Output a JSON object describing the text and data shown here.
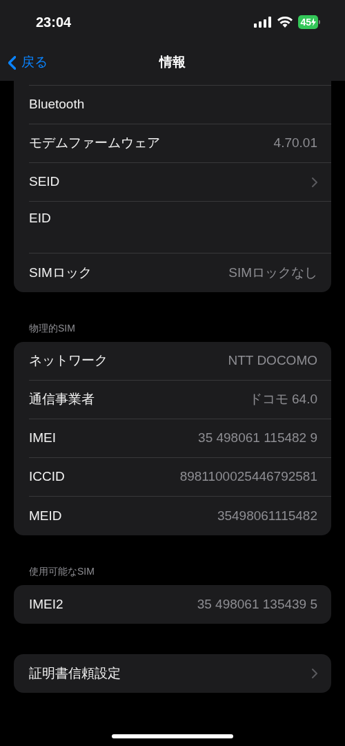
{
  "status_bar": {
    "time": "23:04",
    "battery": "45"
  },
  "nav": {
    "back": "戻る",
    "title": "情報"
  },
  "groups": [
    {
      "rows": [
        {
          "kind": "plain",
          "label": "Bluetooth"
        },
        {
          "kind": "value",
          "label": "モデムファームウェア",
          "value": "4.70.01"
        },
        {
          "kind": "chevron",
          "label": "SEID"
        },
        {
          "kind": "tall",
          "label": "EID"
        },
        {
          "kind": "value",
          "label": "SIMロック",
          "value": "SIMロックなし"
        }
      ]
    },
    {
      "header": "物理的SIM",
      "rows": [
        {
          "kind": "value",
          "label": "ネットワーク",
          "value": "NTT DOCOMO"
        },
        {
          "kind": "value",
          "label": "通信事業者",
          "value": "ドコモ 64.0"
        },
        {
          "kind": "value",
          "label": "IMEI",
          "value": "35 498061 115482 9"
        },
        {
          "kind": "value",
          "label": "ICCID",
          "value": "8981100025446792581"
        },
        {
          "kind": "value",
          "label": "MEID",
          "value": "35498061115482"
        }
      ]
    },
    {
      "header": "使用可能なSIM",
      "rows": [
        {
          "kind": "value",
          "label": "IMEI2",
          "value": "35 498061 135439 5"
        }
      ]
    },
    {
      "rows": [
        {
          "kind": "chevron",
          "label": "証明書信頼設定"
        }
      ]
    }
  ]
}
